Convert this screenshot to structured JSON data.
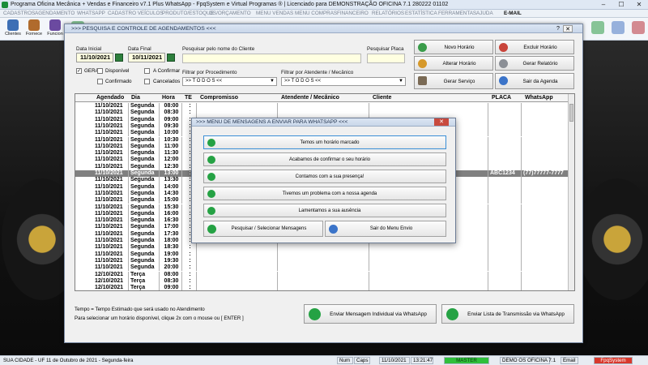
{
  "window": {
    "title": "Programa Oficina Mecânica + Vendas e Financeiro v7.1 Plus WhatsApp - FpqSystem e Virtual Programas ® | Licenciado para  DEMONSTRAÇÃO OFICINA 7.1 280222 01102",
    "min": "–",
    "max": "☐",
    "close": "✕"
  },
  "menu": [
    "CADASTROS",
    "AGENDAMENTO",
    "WHATSAPP",
    "CADASTRO VEÍCULOS",
    "PRODUTO/ESTOQUE",
    "OS/ORÇAMENTO",
    "MENU VENDAS",
    "MENU COMPRAS",
    "FINANCEIRO",
    "RELATÓRIOS",
    "ESTATÍSTICA",
    "FERRAMENTAS",
    "AJUDA"
  ],
  "menu_email": "E-MAIL",
  "toolbar": [
    "Clientes",
    "Fornece",
    "Funcion"
  ],
  "agenda": {
    "title": ">>>  PESQUISA E CONTROLE DE AGENDAMENTOS  <<<",
    "help": "?",
    "close": "✕",
    "data_inicial_label": "Data Inicial",
    "data_inicial": "11/10/2021",
    "data_final_label": "Data Final",
    "data_final": "10/11/2021",
    "pesquisar_cliente_label": "Pesquisar pelo nome do Cliente",
    "pesquisar_placa_label": "Pesquisar Placa",
    "filtrar_procedimento_label": "Filtrar por Procedimento",
    "filtrar_procedimento_value": ">> T O D O S <<",
    "filtrar_atendente_label": "Filtrar por Atendente / Mecânico",
    "filtrar_atendente_value": ">> T O D O S <<",
    "check_geral": "GERAL",
    "check_disponivel": "Disponível",
    "check_confirmado": "Confirmado",
    "check_a_confirmar": "A Confirmar",
    "check_cancelados": "Cancelados",
    "buttons": {
      "novo": "Novo Horário",
      "excluir": "Excluir Horário",
      "alterar": "Alterar Horário",
      "relatorio": "Gerar Relatório",
      "servico": "Gerar  Serviço",
      "sair": "Sair da Agenda"
    },
    "columns": [
      "Agendado",
      "Dia",
      "Hora",
      "TE",
      "Compromisso",
      "Atendente / Mecânico",
      "Cliente",
      "PLACA",
      "WhatsApp"
    ],
    "rows": [
      {
        "date": "11/10/2021",
        "day": "Segunda",
        "time": "08:00",
        "te": ":",
        "placa": "",
        "whats": ""
      },
      {
        "date": "11/10/2021",
        "day": "Segunda",
        "time": "08:30",
        "te": ":",
        "placa": "",
        "whats": ""
      },
      {
        "date": "11/10/2021",
        "day": "Segunda",
        "time": "09:00",
        "te": ":",
        "placa": "",
        "whats": ""
      },
      {
        "date": "11/10/2021",
        "day": "Segunda",
        "time": "09:30",
        "te": ":",
        "placa": "",
        "whats": ""
      },
      {
        "date": "11/10/2021",
        "day": "Segunda",
        "time": "10:00",
        "te": ":",
        "placa": "",
        "whats": ""
      },
      {
        "date": "11/10/2021",
        "day": "Segunda",
        "time": "10:30",
        "te": ":",
        "placa": "",
        "whats": ""
      },
      {
        "date": "11/10/2021",
        "day": "Segunda",
        "time": "11:00",
        "te": ":",
        "placa": "",
        "whats": ""
      },
      {
        "date": "11/10/2021",
        "day": "Segunda",
        "time": "11:30",
        "te": ":",
        "placa": "",
        "whats": ""
      },
      {
        "date": "11/10/2021",
        "day": "Segunda",
        "time": "12:00",
        "te": ":",
        "placa": "",
        "whats": ""
      },
      {
        "date": "11/10/2021",
        "day": "Segunda",
        "time": "12:30",
        "te": ":",
        "placa": "",
        "whats": ""
      },
      {
        "date": "11/10/2021",
        "day": "Segunda",
        "time": "13:00",
        "te": ":",
        "placa": "ABC1234",
        "whats": "(77)77777-7777",
        "selected": true
      },
      {
        "date": "11/10/2021",
        "day": "Segunda",
        "time": "13:30",
        "te": ":",
        "placa": "",
        "whats": ""
      },
      {
        "date": "11/10/2021",
        "day": "Segunda",
        "time": "14:00",
        "te": ":",
        "placa": "",
        "whats": ""
      },
      {
        "date": "11/10/2021",
        "day": "Segunda",
        "time": "14:30",
        "te": ":",
        "placa": "",
        "whats": ""
      },
      {
        "date": "11/10/2021",
        "day": "Segunda",
        "time": "15:00",
        "te": ":",
        "placa": "",
        "whats": ""
      },
      {
        "date": "11/10/2021",
        "day": "Segunda",
        "time": "15:30",
        "te": ":",
        "placa": "",
        "whats": ""
      },
      {
        "date": "11/10/2021",
        "day": "Segunda",
        "time": "16:00",
        "te": ":",
        "placa": "",
        "whats": ""
      },
      {
        "date": "11/10/2021",
        "day": "Segunda",
        "time": "16:30",
        "te": ":",
        "placa": "",
        "whats": ""
      },
      {
        "date": "11/10/2021",
        "day": "Segunda",
        "time": "17:00",
        "te": ":",
        "placa": "",
        "whats": ""
      },
      {
        "date": "11/10/2021",
        "day": "Segunda",
        "time": "17:30",
        "te": ":",
        "placa": "",
        "whats": ""
      },
      {
        "date": "11/10/2021",
        "day": "Segunda",
        "time": "18:00",
        "te": ":",
        "placa": "",
        "whats": ""
      },
      {
        "date": "11/10/2021",
        "day": "Segunda",
        "time": "18:30",
        "te": ":",
        "placa": "",
        "whats": ""
      },
      {
        "date": "11/10/2021",
        "day": "Segunda",
        "time": "19:00",
        "te": ":",
        "placa": "",
        "whats": ""
      },
      {
        "date": "11/10/2021",
        "day": "Segunda",
        "time": "19:30",
        "te": ":",
        "placa": "",
        "whats": ""
      },
      {
        "date": "11/10/2021",
        "day": "Segunda",
        "time": "20:00",
        "te": ":",
        "placa": "",
        "whats": ""
      },
      {
        "date": "12/10/2021",
        "day": "Terça",
        "time": "08:00",
        "te": ":",
        "placa": "",
        "whats": ""
      },
      {
        "date": "12/10/2021",
        "day": "Terça",
        "time": "08:30",
        "te": ":",
        "placa": "",
        "whats": ""
      },
      {
        "date": "12/10/2021",
        "day": "Terça",
        "time": "09:00",
        "te": ":",
        "placa": "",
        "whats": ""
      }
    ],
    "note1": "Tempo = Tempo Estimado que será usado no Atendimento",
    "note2": "Para selecionar um horário disponível, clique 2x com o mouse ou [ ENTER ]",
    "wa_individual": "Enviar Mensagem Individual via WhatsApp",
    "wa_lista": "Enviar Lista de Transmissão via WhatsApp"
  },
  "modal": {
    "title": ">>>  MENU DE MENSAGENS A ENVIAR PARA WHATSAPP  <<<",
    "close": "✕",
    "messages": [
      "Temos um horário marcado",
      "Acabamos de confirmar o seu horário",
      "Contamos com a sua presença!",
      "Tivemos um problema com a nossa agenda",
      "Lamentamos a sua ausência"
    ],
    "search": "Pesquisar / Selecionar Mensagens",
    "exit": "Sair do Menu Envio"
  },
  "status": {
    "left": "SUA CIDADE - UF 11 de Outubro de 2021 - Segunda-feira",
    "num": "Num",
    "caps": "Caps",
    "date": "11/10/2021",
    "time": "13:21:47",
    "master": "MASTER",
    "demo": "DEMO OS OFICINA 7.1",
    "email": "Email",
    "logo": "FpqSystem"
  }
}
